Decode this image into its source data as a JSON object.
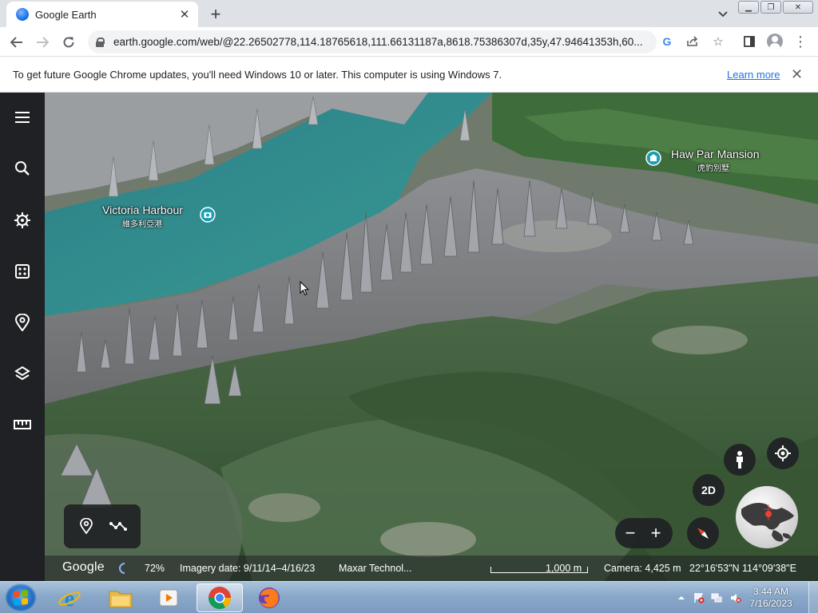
{
  "browser": {
    "tab_title": "Google Earth",
    "url": "earth.google.com/web/@22.26502778,114.18765618,111.66131187a,8618.75386307d,35y,47.94641353h,60...",
    "icons": [
      "back-icon",
      "forward-icon",
      "reload-icon",
      "lock-icon",
      "google-lens-icon",
      "share-icon",
      "bookmark-star-icon",
      "side-panel-icon",
      "profile-icon",
      "menu-kebab-icon"
    ]
  },
  "infobar": {
    "message": "To get future Google Chrome updates, you'll need Windows 10 or later. This computer is using Windows 7.",
    "link": "Learn more"
  },
  "earth": {
    "rail_icons": [
      "menu-icon",
      "search-icon",
      "voyager-icon",
      "feeling-lucky-icon",
      "projects-icon",
      "map-style-icon",
      "measure-icon"
    ],
    "places": [
      {
        "name": "Victoria Harbour",
        "name_zh": "維多利亞港"
      },
      {
        "name": "Haw Par Mansion",
        "name_zh": "虎豹別墅"
      }
    ],
    "buttons": {
      "view_2d": "2D",
      "zoom_out": "−",
      "zoom_in": "+"
    },
    "status": {
      "logo": "Google",
      "progress": "72%",
      "imagery_date": "Imagery date: 9/11/14–4/16/23",
      "attribution": "Maxar Technol...",
      "scale": "1,000 m",
      "camera": "Camera: 4,425 m",
      "coordinates": "22°16'53\"N 114°09'38\"E"
    }
  },
  "taskbar": {
    "apps": [
      "internet-explorer",
      "file-explorer",
      "media-player",
      "google-chrome",
      "firefox"
    ],
    "active_app": "google-chrome",
    "time": "3:44 AM",
    "date": "7/16/2023"
  },
  "colors": {
    "chrome_tabstrip": "#dee1e6",
    "earth_rail": "#202124",
    "link_blue": "#1a73e8",
    "water": "#2f8a8f",
    "taskbar": "#8aa8c9"
  }
}
